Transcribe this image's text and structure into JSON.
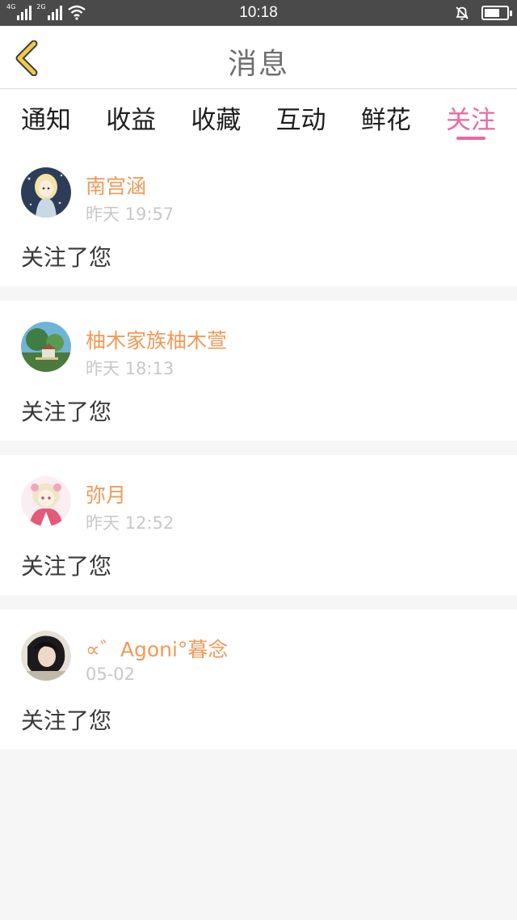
{
  "status_bar": {
    "signal_1_label": "4G",
    "signal_2_label": "2G",
    "time": "10:18",
    "battery_level": 0.7
  },
  "header": {
    "title": "消息"
  },
  "tabs": [
    {
      "label": "通知",
      "active": false
    },
    {
      "label": "收益",
      "active": false
    },
    {
      "label": "收藏",
      "active": false
    },
    {
      "label": "互动",
      "active": false
    },
    {
      "label": "鲜花",
      "active": false
    },
    {
      "label": "关注",
      "active": true
    }
  ],
  "messages": [
    {
      "user": "南宫涵",
      "time": "昨天 19:57",
      "text": "关注了您"
    },
    {
      "user": "柚木家族柚木萱",
      "time": "昨天 18:13",
      "text": "关注了您"
    },
    {
      "user": "弥月",
      "time": "昨天 12:52",
      "text": "关注了您"
    },
    {
      "user": "∝゛Agoni°暮念",
      "time": "05-02",
      "text": "关注了您"
    }
  ],
  "colors": {
    "accent_pink": "#e86aa0",
    "username_orange": "#ef9a57",
    "back_arrow": "#f2c94c",
    "status_bar_bg": "#4a4a4a",
    "page_bg": "#f6f6f6"
  }
}
